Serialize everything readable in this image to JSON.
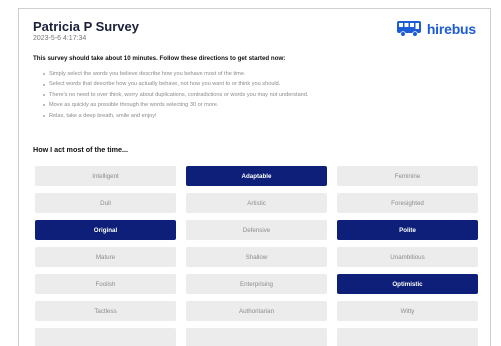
{
  "survey": {
    "title": "Patricia P Survey",
    "datetime": "2023-5-6 4:17:34"
  },
  "brand": {
    "name": "hirebus",
    "icon": "bus-icon",
    "color": "#1e5bd6"
  },
  "intro": "This survey should take about 10 minutes. Follow these directions to get started now:",
  "instructions": [
    "Simply select the words you believe describe how you behave most of the time.",
    "Select words that describe how you actually behave, not how you want to or think you should.",
    "There's no need to over think, worry about duplications, contradictions or words you may not understand.",
    "Move as quickly as possible through the words selecting 30 or more.",
    "Relax, take a deep breath, smile and enjoy!"
  ],
  "section_title": "How I act most of the time...",
  "colors": {
    "selected": "#0d1f78",
    "unselected": "#ececec"
  },
  "words": [
    {
      "label": "Intelligent",
      "selected": false
    },
    {
      "label": "Adaptable",
      "selected": true
    },
    {
      "label": "Feminine",
      "selected": false
    },
    {
      "label": "Dull",
      "selected": false
    },
    {
      "label": "Artistic",
      "selected": false
    },
    {
      "label": "Foresighted",
      "selected": false
    },
    {
      "label": "Original",
      "selected": true
    },
    {
      "label": "Defensive",
      "selected": false
    },
    {
      "label": "Polite",
      "selected": true
    },
    {
      "label": "Mature",
      "selected": false
    },
    {
      "label": "Shallow",
      "selected": false
    },
    {
      "label": "Unambitious",
      "selected": false
    },
    {
      "label": "Foolish",
      "selected": false
    },
    {
      "label": "Enterprising",
      "selected": false
    },
    {
      "label": "Optimistic",
      "selected": true
    },
    {
      "label": "Tactless",
      "selected": false
    },
    {
      "label": "Authoritarian",
      "selected": false
    },
    {
      "label": "Witty",
      "selected": false
    },
    {
      "label": "",
      "selected": false
    },
    {
      "label": "",
      "selected": false
    },
    {
      "label": "",
      "selected": false
    }
  ]
}
